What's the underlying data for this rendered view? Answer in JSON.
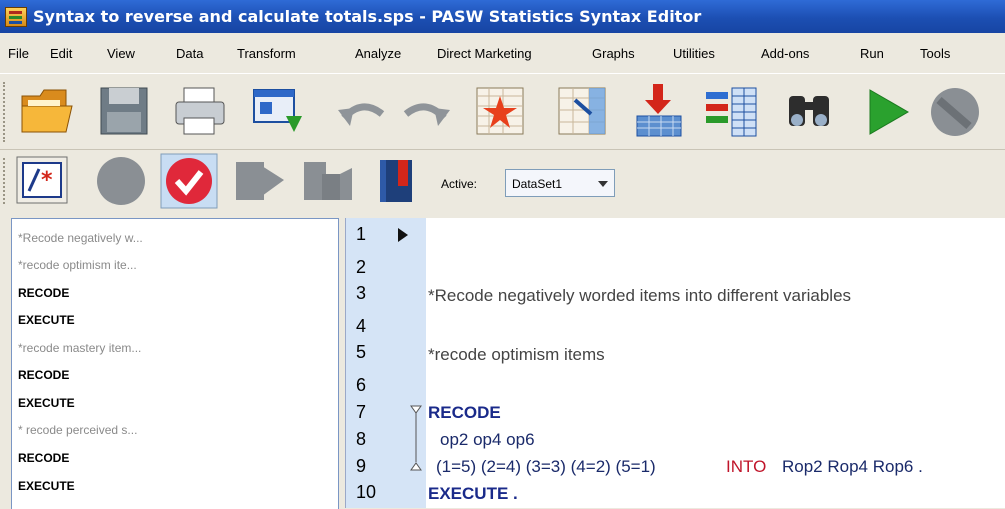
{
  "window": {
    "title": "Syntax to reverse and calculate totals.sps - PASW Statistics Syntax Editor"
  },
  "menu": [
    "File",
    "Edit",
    "View",
    "Data",
    "Transform",
    "Analyze",
    "Direct Marketing",
    "Graphs",
    "Utilities",
    "Add-ons",
    "Run",
    "Tools"
  ],
  "toolbar1": [
    {
      "name": "open-icon"
    },
    {
      "name": "save-icon"
    },
    {
      "name": "print-icon"
    },
    {
      "name": "dialog-recall-icon"
    },
    {
      "name": "undo-icon"
    },
    {
      "name": "redo-icon"
    },
    {
      "name": "goto-case-icon"
    },
    {
      "name": "goto-variable-icon"
    },
    {
      "name": "variables-icon"
    },
    {
      "name": "value-labels-icon"
    },
    {
      "name": "find-icon"
    },
    {
      "name": "run-icon"
    },
    {
      "name": "stop-icon"
    }
  ],
  "toolbar2": {
    "buttons": [
      {
        "name": "comment-icon"
      },
      {
        "name": "breakpoint-icon"
      },
      {
        "name": "validate-icon"
      },
      {
        "name": "step-icon"
      },
      {
        "name": "step-through-icon"
      },
      {
        "name": "bookmark-icon"
      }
    ],
    "active_label": "Active:",
    "active_value": "DataSet1"
  },
  "navigator": {
    "items": [
      {
        "text": "*Recode negatively w...",
        "kind": "comment"
      },
      {
        "text": "*recode optimism ite...",
        "kind": "comment"
      },
      {
        "text": "RECODE",
        "kind": "command"
      },
      {
        "text": "EXECUTE",
        "kind": "command"
      },
      {
        "text": "*recode mastery item...",
        "kind": "comment"
      },
      {
        "text": "RECODE",
        "kind": "command"
      },
      {
        "text": "EXECUTE",
        "kind": "command"
      },
      {
        "text": "* recode perceived s...",
        "kind": "comment"
      },
      {
        "text": "RECODE",
        "kind": "command"
      },
      {
        "text": "EXECUTE",
        "kind": "command"
      }
    ]
  },
  "editor": {
    "line_numbers": [
      "1",
      "2",
      "3",
      "4",
      "5",
      "6",
      "7",
      "8",
      "9",
      "10"
    ],
    "lines": {
      "l3": "*Recode negatively worded items into different variables",
      "l5": "*recode optimism items",
      "l7": "RECODE",
      "l8": "op2 op4 op6",
      "l9a": "(1=5) (2=4) (3=3) (4=2) (5=1)",
      "l9b": "INTO",
      "l9c": "Rop2  Rop4  Rop6 .",
      "l10": "EXECUTE ."
    }
  },
  "colors": {
    "titlebar": "#1c4fb3",
    "gutter": "#d5e4f6",
    "keyword": "#1a2a8a",
    "into": "#c0152a"
  }
}
